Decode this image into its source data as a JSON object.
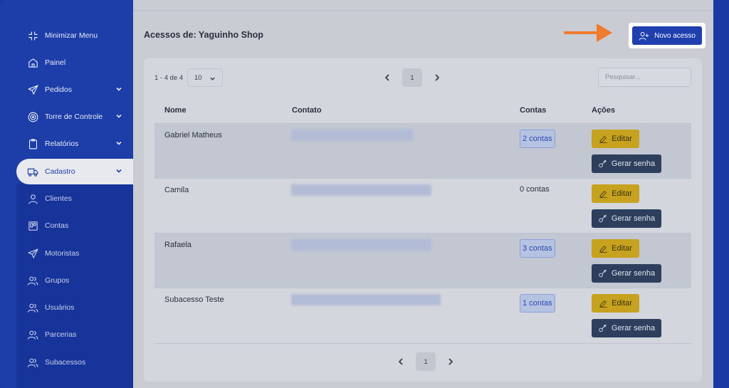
{
  "sidebar": {
    "items": [
      {
        "label": "Minimizar Menu",
        "icon": "minimize-icon"
      },
      {
        "label": "Painel",
        "icon": "home-icon"
      },
      {
        "label": "Pedidos",
        "icon": "send-icon"
      },
      {
        "label": "Torre de Controle",
        "icon": "target-icon"
      },
      {
        "label": "Relatórios",
        "icon": "clipboard-icon"
      },
      {
        "label": "Cadastro",
        "icon": "truck-icon"
      }
    ],
    "subitems": [
      {
        "label": "Clientes",
        "icon": "user-icon"
      },
      {
        "label": "Contas",
        "icon": "account-icon"
      },
      {
        "label": "Motoristas",
        "icon": "send-icon"
      },
      {
        "label": "Grupos",
        "icon": "users-icon"
      },
      {
        "label": "Usuários",
        "icon": "users-icon"
      },
      {
        "label": "Parcerias",
        "icon": "users-icon"
      },
      {
        "label": "Subacessos",
        "icon": "users-icon"
      }
    ]
  },
  "header": {
    "title": "Acessos de: Yaguinho Shop",
    "new_button": "Novo acesso"
  },
  "toolbar": {
    "range": "1 - 4 de 4",
    "per_page": "10",
    "page": "1",
    "search_placeholder": "Pesquisar..."
  },
  "table": {
    "columns": [
      "Nome",
      "Contato",
      "Contas",
      "Ações"
    ],
    "rows": [
      {
        "name": "Gabriel Matheus",
        "contas": "2 contas",
        "contas_link": true
      },
      {
        "name": "Camila",
        "contas": "0 contas",
        "contas_link": false
      },
      {
        "name": "Rafaela",
        "contas": "3 contas",
        "contas_link": true
      },
      {
        "name": "Subacesso Teste",
        "contas": "1 contas",
        "contas_link": true
      }
    ],
    "edit_label": "Editar",
    "password_label": "Gerar senha"
  },
  "footer": {
    "page": "1"
  },
  "colors": {
    "brand": "#1d3ea8",
    "edit": "#c6a21e",
    "password": "#2e3f5e",
    "arrow": "#f07a2e"
  }
}
